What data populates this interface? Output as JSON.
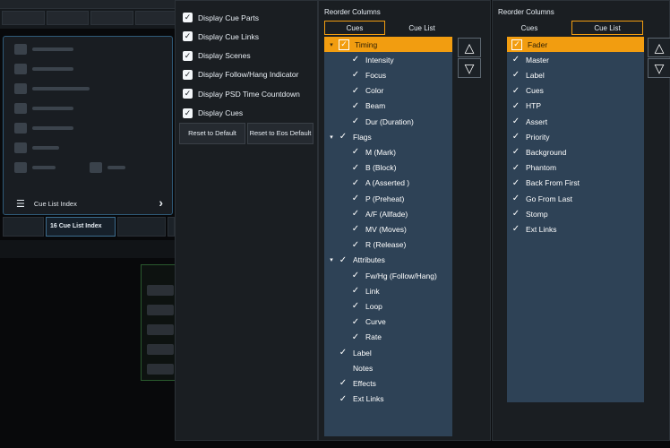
{
  "menu": {
    "cue_list_index_label": "Cue List Index",
    "chevron_icon": "chevron-right-icon"
  },
  "tabs": {
    "active_label": "16 Cue List Index"
  },
  "options": {
    "items": [
      {
        "label": "Display Cue Parts",
        "checked": true
      },
      {
        "label": "Display Cue Links",
        "checked": true
      },
      {
        "label": "Display Scenes",
        "checked": true
      },
      {
        "label": "Display Follow/Hang Indicator",
        "checked": true
      },
      {
        "label": "Display PSD Time Countdown",
        "checked": true
      },
      {
        "label": "Display Cues",
        "checked": true
      }
    ],
    "reset_default_label": "Reset to Default",
    "reset_eos_label": "Reset to Eos Default"
  },
  "reorder_cues": {
    "title": "Reorder Columns",
    "tabs": [
      "Cues",
      "Cue List"
    ],
    "selected_tab": "Cues",
    "items": [
      {
        "label": "Timing",
        "level": 0,
        "expand": true,
        "checked": true,
        "highlighted": true
      },
      {
        "label": "Intensity",
        "level": 1,
        "checked": true
      },
      {
        "label": "Focus",
        "level": 1,
        "checked": true
      },
      {
        "label": "Color",
        "level": 1,
        "checked": true
      },
      {
        "label": "Beam",
        "level": 1,
        "checked": true
      },
      {
        "label": "Dur (Duration)",
        "level": 1,
        "checked": true
      },
      {
        "label": "Flags",
        "level": 0,
        "expand": true,
        "checked": true
      },
      {
        "label": "M (Mark)",
        "level": 1,
        "checked": true
      },
      {
        "label": "B (Block)",
        "level": 1,
        "checked": true
      },
      {
        "label": "A (Asserted )",
        "level": 1,
        "checked": true
      },
      {
        "label": "P (Preheat)",
        "level": 1,
        "checked": true
      },
      {
        "label": "A/F (Allfade)",
        "level": 1,
        "checked": true
      },
      {
        "label": "MV (Moves)",
        "level": 1,
        "checked": true
      },
      {
        "label": "R (Release)",
        "level": 1,
        "checked": true
      },
      {
        "label": "Attributes",
        "level": 0,
        "expand": true,
        "checked": true
      },
      {
        "label": "Fw/Hg (Follow/Hang)",
        "level": 1,
        "checked": true
      },
      {
        "label": "Link",
        "level": 1,
        "checked": true
      },
      {
        "label": "Loop",
        "level": 1,
        "checked": true
      },
      {
        "label": "Curve",
        "level": 1,
        "checked": true
      },
      {
        "label": "Rate",
        "level": 1,
        "checked": true
      },
      {
        "label": "Label",
        "level": 0,
        "checked": true
      },
      {
        "label": "Notes",
        "level": 0,
        "checked": false
      },
      {
        "label": "Effects",
        "level": 0,
        "checked": true
      },
      {
        "label": "Ext Links",
        "level": 0,
        "checked": true
      }
    ]
  },
  "reorder_cuelist": {
    "title": "Reorder Columns",
    "tabs": [
      "Cues",
      "Cue List"
    ],
    "selected_tab": "Cue List",
    "items": [
      {
        "label": "Fader",
        "checked": true,
        "highlighted": true
      },
      {
        "label": "Master",
        "checked": true
      },
      {
        "label": "Label",
        "checked": true
      },
      {
        "label": "Cues",
        "checked": true
      },
      {
        "label": "HTP",
        "checked": true
      },
      {
        "label": "Assert",
        "checked": true
      },
      {
        "label": "Priority",
        "checked": true
      },
      {
        "label": "Background",
        "checked": true
      },
      {
        "label": "Phantom",
        "checked": true
      },
      {
        "label": "Back From First",
        "checked": true
      },
      {
        "label": "Go From Last",
        "checked": true
      },
      {
        "label": "Stomp",
        "checked": true
      },
      {
        "label": "Ext Links",
        "checked": true
      }
    ]
  },
  "arrows": {
    "up": "△",
    "down": "▽"
  },
  "colors": {
    "accent": "#f29d10",
    "list_bg": "#2e4256",
    "panel_bg": "#1a1e22"
  }
}
